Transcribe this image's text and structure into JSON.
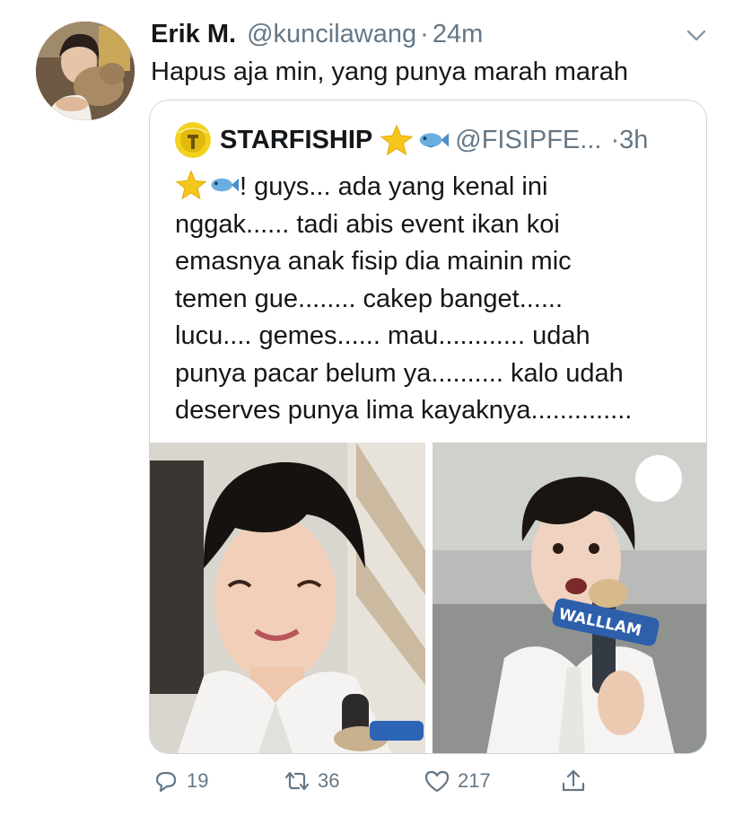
{
  "tweet": {
    "author_name": "Erik M.",
    "author_handle": "@kuncilawang",
    "separator": "·",
    "time": "24m",
    "text": "Hapus aja min, yang punya marah marah"
  },
  "quoted": {
    "name": "STARFISHIP",
    "handle": "@FISIPFE...",
    "time": "·3h",
    "lines": [
      "! guys... ada yang kenal ini",
      "nggak...... tadi abis event ikan koi",
      "emasnya anak fisip dia mainin mic",
      "temen gue........ cakep banget......",
      "lucu.... gemes...... mau............ udah",
      "punya pacar belum ya.......... kalo udah",
      "deserves punya lima kayaknya.............."
    ],
    "mic_label": "WALLLAM"
  },
  "actions": {
    "reply_count": "19",
    "retweet_count": "36",
    "like_count": "217"
  },
  "icons": {
    "caret": "chevron-down-icon",
    "reply": "reply-icon",
    "retweet": "retweet-icon",
    "like": "heart-icon",
    "share": "share-icon",
    "star": "star-emoji",
    "fish": "fish-emoji"
  },
  "colors": {
    "text": "#14171a",
    "secondary": "#657786",
    "border": "#ccd6dd",
    "star": "#f5c518",
    "fish": "#5aa0d8"
  }
}
